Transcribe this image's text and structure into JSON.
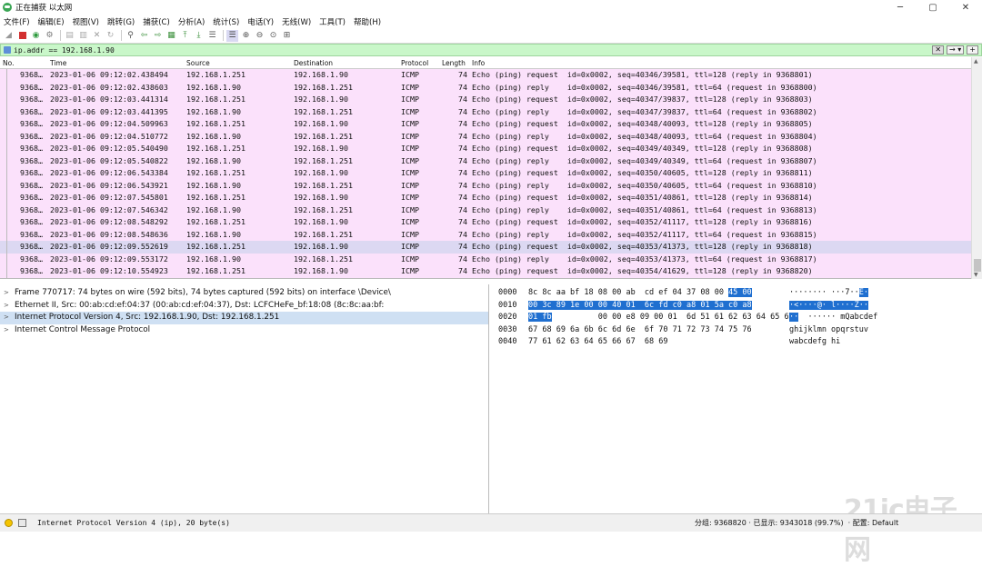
{
  "window": {
    "title": "正在捕获 以太网"
  },
  "menu": [
    "文件(F)",
    "编辑(E)",
    "视图(V)",
    "跳转(G)",
    "捕获(C)",
    "分析(A)",
    "统计(S)",
    "电话(Y)",
    "无线(W)",
    "工具(T)",
    "帮助(H)"
  ],
  "filter": {
    "value": "ip.addr == 192.168.1.90"
  },
  "columns": [
    "No.",
    "Time",
    "Source",
    "Destination",
    "Protocol",
    "Length",
    "Info"
  ],
  "packets": [
    [
      "9368…",
      "2023-01-06 09:12:02.438494",
      "192.168.1.251",
      "192.168.1.90",
      "ICMP",
      "74",
      "Echo (ping) request  id=0x0002, seq=40346/39581, ttl=128 (reply in 9368801)"
    ],
    [
      "9368…",
      "2023-01-06 09:12:02.438603",
      "192.168.1.90",
      "192.168.1.251",
      "ICMP",
      "74",
      "Echo (ping) reply    id=0x0002, seq=40346/39581, ttl=64 (request in 9368800)"
    ],
    [
      "9368…",
      "2023-01-06 09:12:03.441314",
      "192.168.1.251",
      "192.168.1.90",
      "ICMP",
      "74",
      "Echo (ping) request  id=0x0002, seq=40347/39837, ttl=128 (reply in 9368803)"
    ],
    [
      "9368…",
      "2023-01-06 09:12:03.441395",
      "192.168.1.90",
      "192.168.1.251",
      "ICMP",
      "74",
      "Echo (ping) reply    id=0x0002, seq=40347/39837, ttl=64 (request in 9368802)"
    ],
    [
      "9368…",
      "2023-01-06 09:12:04.509963",
      "192.168.1.251",
      "192.168.1.90",
      "ICMP",
      "74",
      "Echo (ping) request  id=0x0002, seq=40348/40093, ttl=128 (reply in 9368805)"
    ],
    [
      "9368…",
      "2023-01-06 09:12:04.510772",
      "192.168.1.90",
      "192.168.1.251",
      "ICMP",
      "74",
      "Echo (ping) reply    id=0x0002, seq=40348/40093, ttl=64 (request in 9368804)"
    ],
    [
      "9368…",
      "2023-01-06 09:12:05.540490",
      "192.168.1.251",
      "192.168.1.90",
      "ICMP",
      "74",
      "Echo (ping) request  id=0x0002, seq=40349/40349, ttl=128 (reply in 9368808)"
    ],
    [
      "9368…",
      "2023-01-06 09:12:05.540822",
      "192.168.1.90",
      "192.168.1.251",
      "ICMP",
      "74",
      "Echo (ping) reply    id=0x0002, seq=40349/40349, ttl=64 (request in 9368807)"
    ],
    [
      "9368…",
      "2023-01-06 09:12:06.543384",
      "192.168.1.251",
      "192.168.1.90",
      "ICMP",
      "74",
      "Echo (ping) request  id=0x0002, seq=40350/40605, ttl=128 (reply in 9368811)"
    ],
    [
      "9368…",
      "2023-01-06 09:12:06.543921",
      "192.168.1.90",
      "192.168.1.251",
      "ICMP",
      "74",
      "Echo (ping) reply    id=0x0002, seq=40350/40605, ttl=64 (request in 9368810)"
    ],
    [
      "9368…",
      "2023-01-06 09:12:07.545801",
      "192.168.1.251",
      "192.168.1.90",
      "ICMP",
      "74",
      "Echo (ping) request  id=0x0002, seq=40351/40861, ttl=128 (reply in 9368814)"
    ],
    [
      "9368…",
      "2023-01-06 09:12:07.546342",
      "192.168.1.90",
      "192.168.1.251",
      "ICMP",
      "74",
      "Echo (ping) reply    id=0x0002, seq=40351/40861, ttl=64 (request in 9368813)"
    ],
    [
      "9368…",
      "2023-01-06 09:12:08.548292",
      "192.168.1.251",
      "192.168.1.90",
      "ICMP",
      "74",
      "Echo (ping) request  id=0x0002, seq=40352/41117, ttl=128 (reply in 9368816)"
    ],
    [
      "9368…",
      "2023-01-06 09:12:08.548636",
      "192.168.1.90",
      "192.168.1.251",
      "ICMP",
      "74",
      "Echo (ping) reply    id=0x0002, seq=40352/41117, ttl=64 (request in 9368815)"
    ],
    [
      "9368…",
      "2023-01-06 09:12:09.552619",
      "192.168.1.251",
      "192.168.1.90",
      "ICMP",
      "74",
      "Echo (ping) request  id=0x0002, seq=40353/41373, ttl=128 (reply in 9368818)"
    ],
    [
      "9368…",
      "2023-01-06 09:12:09.553172",
      "192.168.1.90",
      "192.168.1.251",
      "ICMP",
      "74",
      "Echo (ping) reply    id=0x0002, seq=40353/41373, ttl=64 (request in 9368817)"
    ],
    [
      "9368…",
      "2023-01-06 09:12:10.554923",
      "192.168.1.251",
      "192.168.1.90",
      "ICMP",
      "74",
      "Echo (ping) request  id=0x0002, seq=40354/41629, ttl=128 (reply in 9368820)"
    ]
  ],
  "selected_packet_index": 14,
  "details": [
    {
      "text": "Frame 770717: 74 bytes on wire (592 bits), 74 bytes captured (592 bits) on interface \\Device\\",
      "selected": false
    },
    {
      "text": "Ethernet II, Src: 00:ab:cd:ef:04:37 (00:ab:cd:ef:04:37), Dst: LCFCHeFe_bf:18:08 (8c:8c:aa:bf:",
      "selected": false
    },
    {
      "text": "Internet Protocol Version 4, Src: 192.168.1.90, Dst: 192.168.1.251",
      "selected": true
    },
    {
      "text": "Internet Control Message Protocol",
      "selected": false
    }
  ],
  "hex": {
    "offsets": [
      "0000",
      "0010",
      "0020",
      "0030",
      "0040"
    ],
    "bytes_plain": [
      "8c 8c aa bf 18 08 00 ab  cd ef 04 37 08 00 ",
      "",
      "          00 00 e8 09 00 01  6d 51 61 62 63 64 65 66",
      "67 68 69 6a 6b 6c 6d 6e  6f 70 71 72 73 74 75 76",
      "77 61 62 63 64 65 66 67  68 69"
    ],
    "bytes_sel": [
      "45 00",
      "00 3c 89 1e 00 00 40 01  6c fd c0 a8 01 5a c0 a8",
      "01 fb",
      "",
      ""
    ],
    "ascii_plain": [
      "········ ···7··",
      "",
      "  ······ mQabcdef",
      "ghijklmn opqrstuv",
      "wabcdefg hi"
    ],
    "ascii_sel": [
      "E·",
      "·<····@· l····Z··",
      "··",
      "",
      ""
    ]
  },
  "status": {
    "left": "Internet Protocol Version 4 (ip), 20 byte(s)",
    "right": "分组: 9368820 · 已显示: 9343018 (99.7%)  · 配置: Default"
  },
  "watermark": "21ic电子网",
  "colors": {
    "icmp_row": "#fbe1fb",
    "selected_row": "#dcd8f2",
    "hex_highlight": "#1f6fd0",
    "filter_bg": "#c9f7c9"
  }
}
